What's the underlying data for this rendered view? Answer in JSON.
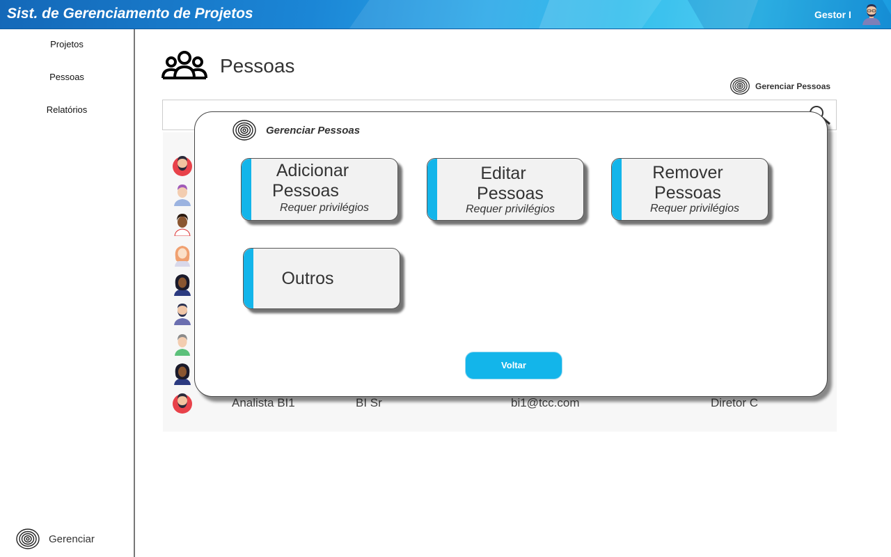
{
  "header": {
    "app_title": "Sist. de Gerenciamento de Projetos",
    "user_name": "Gestor I"
  },
  "sidebar": {
    "items": [
      {
        "label": "Projetos"
      },
      {
        "label": "Pessoas"
      },
      {
        "label": "Relatórios"
      }
    ],
    "manage_label": "Gerenciar"
  },
  "main": {
    "page_title": "Pessoas",
    "manage_people_link": "Gerenciar Pessoas",
    "visible_row": {
      "cargo": "Analista BI1",
      "nivel": "BI Sr",
      "email": "bi1@tcc.com",
      "gestor": "Diretor C"
    }
  },
  "modal": {
    "title": "Gerenciar Pessoas",
    "options": [
      {
        "line1": "Adicionar",
        "line2": "Pessoas",
        "note": "Requer privilégios"
      },
      {
        "line1": "Editar",
        "line2": "Pessoas",
        "note": "Requer privilégios"
      },
      {
        "line1": "Remover",
        "line2": "Pessoas",
        "note": "Requer privilégios"
      },
      {
        "line1": "Outros"
      }
    ],
    "back_label": "Voltar"
  },
  "colors": {
    "accent": "#13b5ea",
    "header_dark": "#1468b8"
  },
  "icons": {
    "page": "people-group-icon",
    "manage": "fingerprint-icon",
    "search": "search-icon"
  }
}
